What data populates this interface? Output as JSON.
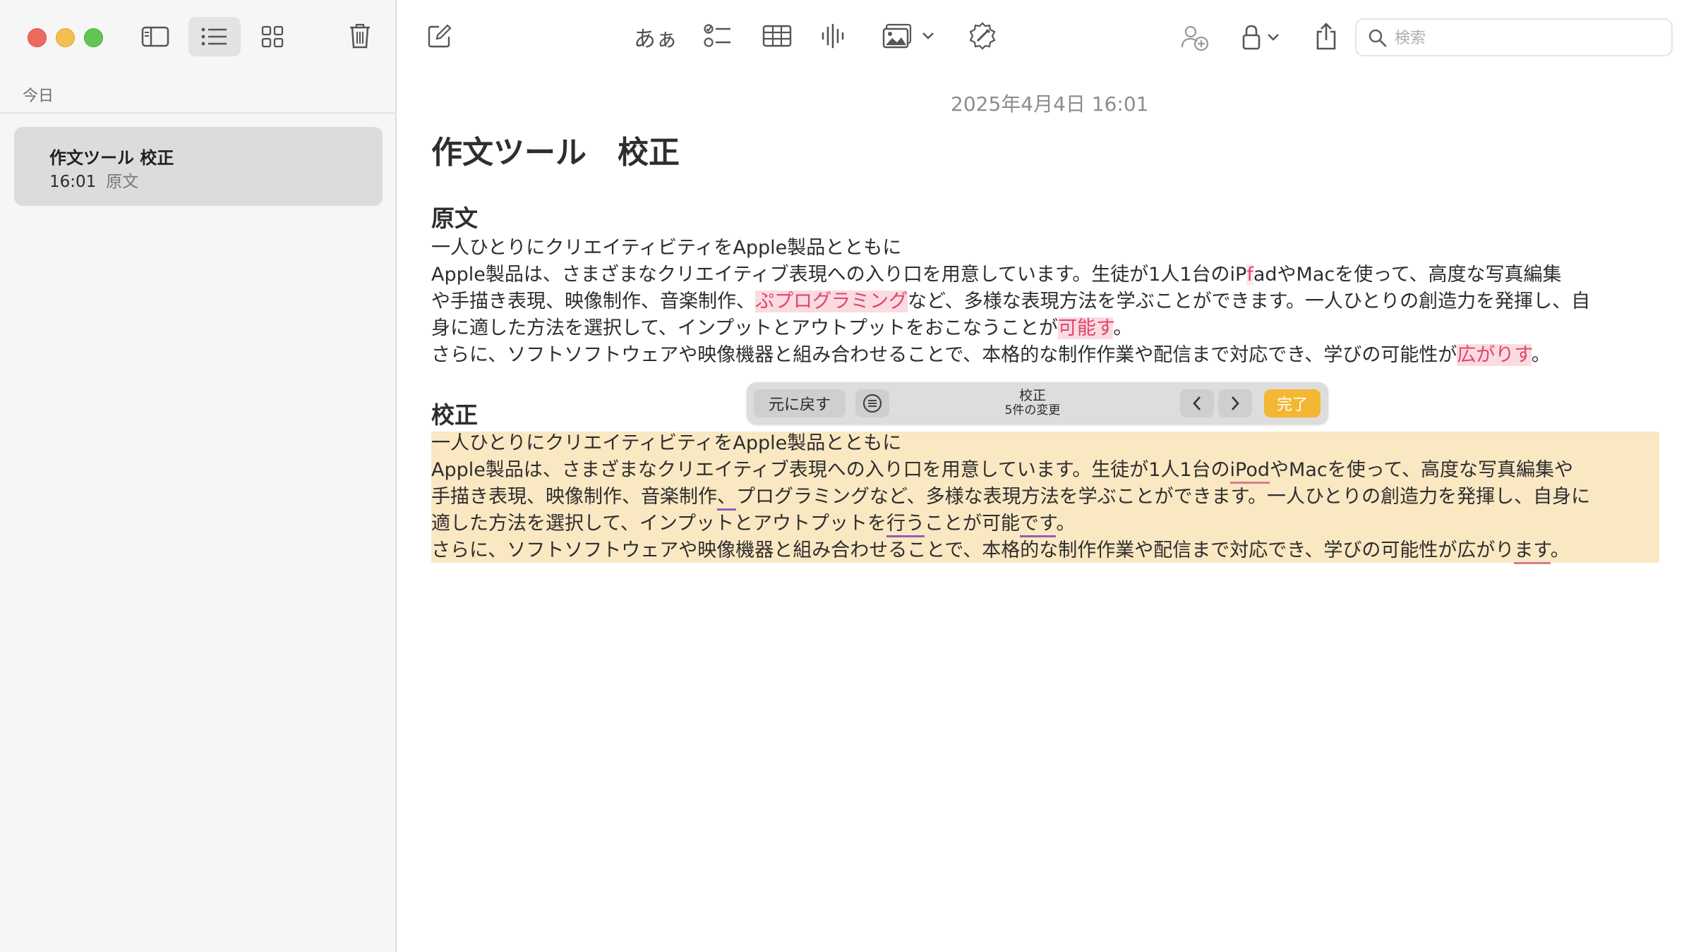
{
  "sidebar": {
    "section_label": "今日",
    "note": {
      "title": "作文ツール 校正",
      "time": "16:01",
      "preview": "原文"
    }
  },
  "toolbar": {
    "font_label": "あぁ",
    "search_placeholder": "検索"
  },
  "note": {
    "date": "2025年4月4日 16:01",
    "title": "作文ツール　校正",
    "original": {
      "heading": "原文",
      "line1": "一人ひとりにクリエイティビティをApple製品とともに",
      "line2a": "Apple製品は、さまざまなクリエイティブ表現への入り口を用意しています。生徒が1人1台のiP",
      "line2_err": "f",
      "line2b": "adやMacを使って、高度な写真編集",
      "line3a": "や手描き表現、映像制作、音楽制作、",
      "line3_err": "ぷプログラミング",
      "line3b": "など、多様な表現方法を学ぶことができます。一人ひとりの創造力を発揮し、自",
      "line4a": "身に適した方法を選択して、インプットとアウトプットをおこなうことが",
      "line4_err": "可能す",
      "line4b": "。",
      "line5a": "さらに、ソフトソフトウェアや映像機器と組み合わせることで、本格的な制作作業や配信まで対応でき、学びの可能性が",
      "line5_err": "広がりす",
      "line5b": "。"
    },
    "proofread": {
      "heading": "校正",
      "line1": "一人ひとりにクリエイティビティをApple製品とともに",
      "line2a": "Apple製品は、さまざまなクリエイティブ表現への入り口を用意しています。生徒が1人1台の",
      "line2_fix": "iPod",
      "line2b": "やMacを使って、高度な写真編集や",
      "line3a": "手描き表現、映像制作、音楽制作",
      "line3_fix": "、",
      "line3b": "プログラミングなど、多様な表現方法を学ぶことができます。一人ひとりの創造力を発揮し、自身に",
      "line4a": "適した方法を選択して、インプットとアウトプットを",
      "line4_fix": "行う",
      "line4b": "ことが可能",
      "line4_fix2": "です",
      "line4c": "。",
      "line5a": "さらに、ソフトソフトウェアや映像機器と組み合わせることで、本格的な制作作業や配信まで対応でき、学びの可能性が広がり",
      "line5_fix": "ます",
      "line5b": "。"
    }
  },
  "proofread_bar": {
    "revert_label": "元に戻す",
    "title": "校正",
    "subtitle": "5件の変更",
    "done_label": "完了"
  }
}
